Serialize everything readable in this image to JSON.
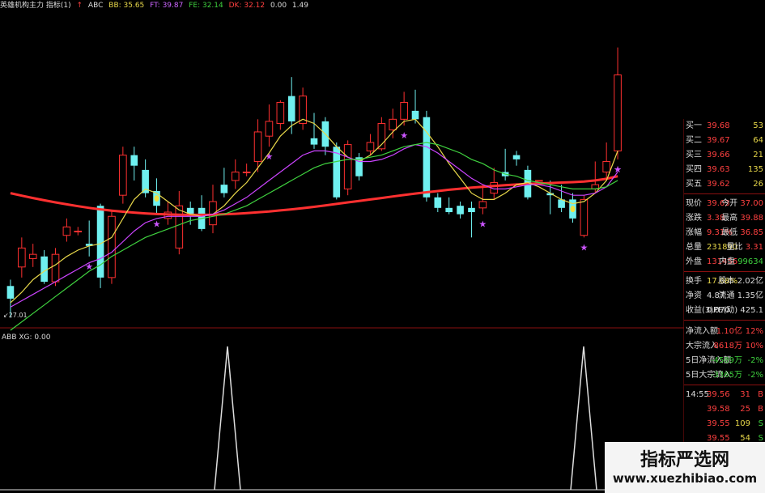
{
  "header": {
    "items": [
      {
        "text": "英雄机构主力 指标(1)",
        "color": "#dddddd"
      },
      {
        "text": "ABC",
        "color": "#dddddd"
      },
      {
        "text": "BB: 35.65",
        "color": "#e8d84a"
      },
      {
        "text": "FT: 39.87",
        "color": "#cc66ff"
      },
      {
        "text": "FE: 32.14",
        "color": "#3fd13f"
      },
      {
        "text": "DK: 32.12",
        "color": "#ff4040"
      },
      {
        "text": "0.00",
        "color": "#dddddd"
      },
      {
        "text": "1.49",
        "color": "#dddddd"
      }
    ]
  },
  "chart_data": [
    {
      "type": "candlestick",
      "title": "",
      "low_label": "27.01",
      "ylim": [
        27.0,
        41.0
      ],
      "candles": [
        {
          "o": 28.6,
          "c": 28.0,
          "h": 28.9,
          "l": 27.1
        },
        {
          "o": 29.5,
          "c": 30.4,
          "h": 30.9,
          "l": 29.0
        },
        {
          "o": 29.9,
          "c": 30.1,
          "h": 30.6,
          "l": 29.5
        },
        {
          "o": 30.0,
          "c": 28.8,
          "h": 30.3,
          "l": 28.7
        },
        {
          "o": 28.8,
          "c": 30.1,
          "h": 30.4,
          "l": 28.6
        },
        {
          "o": 31.0,
          "c": 31.4,
          "h": 31.8,
          "l": 30.7
        },
        {
          "o": 31.2,
          "c": 31.2,
          "h": 31.4,
          "l": 31.0
        },
        {
          "o": 30.6,
          "c": 30.5,
          "h": 31.7,
          "l": 30.0
        },
        {
          "o": 32.4,
          "c": 29.0,
          "h": 32.5,
          "l": 28.5
        },
        {
          "o": 29.0,
          "c": 31.9,
          "h": 32.2,
          "l": 28.7
        },
        {
          "o": 32.9,
          "c": 34.8,
          "h": 35.2,
          "l": 32.5
        },
        {
          "o": 34.8,
          "c": 34.3,
          "h": 35.2,
          "l": 33.6
        },
        {
          "o": 34.1,
          "c": 33.0,
          "h": 34.6,
          "l": 32.8
        },
        {
          "o": 33.1,
          "c": 32.4,
          "h": 33.7,
          "l": 32.0
        },
        {
          "o": 31.8,
          "c": 32.1,
          "h": 32.6,
          "l": 31.5
        },
        {
          "o": 30.4,
          "c": 32.4,
          "h": 33.1,
          "l": 30.1
        },
        {
          "o": 32.3,
          "c": 31.9,
          "h": 32.6,
          "l": 31.5
        },
        {
          "o": 32.3,
          "c": 31.3,
          "h": 32.9,
          "l": 31.2
        },
        {
          "o": 31.5,
          "c": 32.6,
          "h": 33.4,
          "l": 31.1
        },
        {
          "o": 33.4,
          "c": 33.0,
          "h": 34.2,
          "l": 32.8
        },
        {
          "o": 33.6,
          "c": 34.0,
          "h": 34.6,
          "l": 33.2
        },
        {
          "o": 34.0,
          "c": 34.0,
          "h": 34.4,
          "l": 33.8
        },
        {
          "o": 34.5,
          "c": 35.9,
          "h": 36.5,
          "l": 34.0
        },
        {
          "o": 35.7,
          "c": 36.4,
          "h": 37.2,
          "l": 35.2
        },
        {
          "o": 36.3,
          "c": 37.3,
          "h": 37.4,
          "l": 36.0
        },
        {
          "o": 37.6,
          "c": 36.4,
          "h": 38.5,
          "l": 35.8
        },
        {
          "o": 36.3,
          "c": 37.6,
          "h": 38.0,
          "l": 36.0
        },
        {
          "o": 35.6,
          "c": 35.3,
          "h": 36.8,
          "l": 35.1
        },
        {
          "o": 36.4,
          "c": 35.2,
          "h": 36.6,
          "l": 34.8
        },
        {
          "o": 35.2,
          "c": 32.8,
          "h": 35.4,
          "l": 32.7
        },
        {
          "o": 33.2,
          "c": 35.3,
          "h": 35.5,
          "l": 32.9
        },
        {
          "o": 34.7,
          "c": 33.8,
          "h": 34.9,
          "l": 33.6
        },
        {
          "o": 35.0,
          "c": 35.4,
          "h": 35.8,
          "l": 34.8
        },
        {
          "o": 35.1,
          "c": 36.3,
          "h": 36.6,
          "l": 35.0
        },
        {
          "o": 36.0,
          "c": 36.5,
          "h": 37.0,
          "l": 35.6
        },
        {
          "o": 36.5,
          "c": 37.3,
          "h": 37.8,
          "l": 36.2
        },
        {
          "o": 36.9,
          "c": 36.5,
          "h": 37.9,
          "l": 36.3
        },
        {
          "o": 36.6,
          "c": 32.8,
          "h": 36.9,
          "l": 32.6
        },
        {
          "o": 32.8,
          "c": 32.3,
          "h": 33.0,
          "l": 32.1
        },
        {
          "o": 32.3,
          "c": 32.1,
          "h": 32.8,
          "l": 32.0
        },
        {
          "o": 32.4,
          "c": 32.0,
          "h": 32.6,
          "l": 31.8
        },
        {
          "o": 32.3,
          "c": 32.1,
          "h": 32.6,
          "l": 30.9
        },
        {
          "o": 32.3,
          "c": 32.6,
          "h": 33.4,
          "l": 32.0
        },
        {
          "o": 33.0,
          "c": 33.5,
          "h": 34.2,
          "l": 32.7
        },
        {
          "o": 34.0,
          "c": 33.8,
          "h": 35.1,
          "l": 33.6
        },
        {
          "o": 34.8,
          "c": 34.6,
          "h": 35.0,
          "l": 34.3
        },
        {
          "o": 34.1,
          "c": 32.8,
          "h": 34.3,
          "l": 32.7
        },
        {
          "o": 33.6,
          "c": 33.6,
          "h": 33.6,
          "l": 33.6
        },
        {
          "o": 33.0,
          "c": 32.9,
          "h": 33.6,
          "l": 32.0
        },
        {
          "o": 32.7,
          "c": 32.3,
          "h": 33.4,
          "l": 32.1
        },
        {
          "o": 32.7,
          "c": 31.8,
          "h": 33.0,
          "l": 31.6
        },
        {
          "o": 31.0,
          "c": 32.7,
          "h": 32.9,
          "l": 30.9
        },
        {
          "o": 33.2,
          "c": 33.4,
          "h": 34.5,
          "l": 33.0
        },
        {
          "o": 34.0,
          "c": 34.5,
          "h": 35.4,
          "l": 33.6
        },
        {
          "o": 35.0,
          "c": 38.6,
          "h": 39.9,
          "l": 34.6
        }
      ],
      "lines": [
        {
          "color": "#ff3030",
          "values": [
            33.0,
            32.88,
            32.77,
            32.66,
            32.56,
            32.47,
            32.38,
            32.3,
            32.23,
            32.17,
            32.12,
            32.08,
            32.04,
            32.01,
            31.99,
            31.98,
            31.97,
            31.97,
            31.98,
            32.0,
            32.02,
            32.05,
            32.09,
            32.13,
            32.18,
            32.23,
            32.29,
            32.35,
            32.42,
            32.49,
            32.56,
            32.63,
            32.7,
            32.77,
            32.84,
            32.91,
            32.98,
            33.04,
            33.1,
            33.16,
            33.21,
            33.26,
            33.3,
            33.34,
            33.38,
            33.41,
            33.44,
            33.46,
            33.48,
            33.5,
            33.52,
            33.55,
            33.6,
            33.68,
            33.8
          ]
        },
        {
          "color": "#e8d84a",
          "values": [
            27.8,
            28.3,
            28.9,
            29.3,
            29.6,
            30.0,
            30.3,
            30.5,
            30.6,
            30.9,
            31.8,
            32.7,
            33.2,
            33.0,
            32.6,
            32.2,
            32.0,
            31.9,
            32.0,
            32.4,
            33.0,
            33.5,
            34.2,
            34.9,
            35.7,
            36.2,
            36.5,
            36.3,
            35.8,
            35.2,
            34.7,
            34.5,
            34.8,
            35.3,
            35.9,
            36.4,
            36.5,
            35.9,
            35.2,
            34.4,
            33.7,
            33.0,
            32.7,
            32.7,
            33.0,
            33.4,
            33.5,
            33.3,
            33.0,
            32.7,
            32.5,
            32.6,
            33.0,
            33.6,
            35.0
          ]
        },
        {
          "color": "#cc44ff",
          "values": [
            27.6,
            27.9,
            28.2,
            28.5,
            28.8,
            29.1,
            29.4,
            29.7,
            29.9,
            30.2,
            30.7,
            31.2,
            31.6,
            31.8,
            31.9,
            31.9,
            31.9,
            31.9,
            32.0,
            32.2,
            32.5,
            32.8,
            33.2,
            33.6,
            34.0,
            34.4,
            34.8,
            35.0,
            35.0,
            34.9,
            34.7,
            34.5,
            34.5,
            34.6,
            34.8,
            35.1,
            35.3,
            35.2,
            34.9,
            34.5,
            34.1,
            33.7,
            33.4,
            33.2,
            33.2,
            33.3,
            33.4,
            33.4,
            33.3,
            33.1,
            32.9,
            32.9,
            33.0,
            33.3,
            34.0
          ]
        },
        {
          "color": "#3fd13f",
          "values": [
            26.5,
            26.9,
            27.3,
            27.7,
            28.1,
            28.5,
            28.9,
            29.3,
            29.6,
            30.0,
            30.3,
            30.6,
            30.9,
            31.1,
            31.3,
            31.5,
            31.7,
            31.8,
            31.9,
            32.0,
            32.2,
            32.4,
            32.7,
            33.0,
            33.3,
            33.6,
            33.9,
            34.2,
            34.4,
            34.5,
            34.6,
            34.6,
            34.7,
            34.8,
            35.0,
            35.2,
            35.3,
            35.4,
            35.3,
            35.1,
            34.9,
            34.6,
            34.4,
            34.1,
            33.9,
            33.8,
            33.6,
            33.5,
            33.4,
            33.3,
            33.2,
            33.2,
            33.2,
            33.3,
            33.6
          ]
        }
      ],
      "series": [
        {
          "name": "BB",
          "values": [],
          "color": "#e8d84a"
        },
        {
          "name": "FT",
          "values": [],
          "color": "#cc66ff"
        },
        {
          "name": "FE",
          "values": [],
          "color": "#3fd13f"
        },
        {
          "name": "DK",
          "values": [],
          "color": "#ff4040"
        }
      ],
      "buy_stars": [
        7,
        13,
        23,
        35,
        42,
        51,
        56,
        62
      ],
      "dots": [
        13,
        50
      ]
    },
    {
      "type": "line",
      "title": "ABB XG: 0.00",
      "ylim": [
        0,
        1
      ],
      "spikes": [
        {
          "center": 281,
          "value": 1
        },
        {
          "center": 721,
          "value": 1
        }
      ],
      "color": "#dddddd"
    }
  ],
  "quote_panel": {
    "bids": [
      {
        "label": "买一",
        "price": "39.68",
        "vol": "53"
      },
      {
        "label": "买二",
        "price": "39.67",
        "vol": "64"
      },
      {
        "label": "买三",
        "price": "39.66",
        "vol": "21"
      },
      {
        "label": "买四",
        "price": "39.63",
        "vol": "135"
      },
      {
        "label": "买五",
        "price": "39.62",
        "vol": "26"
      }
    ],
    "stats": [
      {
        "l1": "现价",
        "v1": "39.63",
        "l2": "今开",
        "v2": "37.00"
      },
      {
        "l1": "涨跌",
        "v1": "3.38",
        "l2": "最高",
        "v2": "39.88"
      },
      {
        "l1": "涨幅",
        "v1": "9.31%",
        "l2": "最低",
        "v2": "36.85"
      },
      {
        "l1": "总量",
        "v1": "231890",
        "l2": "量比",
        "v2": "3.31"
      },
      {
        "l1": "外盘",
        "v1": "131456",
        "l2": "内盘",
        "v2": "99634"
      },
      {
        "l1": "换手",
        "v1": "17.08%",
        "l2": "股本",
        "v2": "2.02亿"
      },
      {
        "l1": "净资",
        "v1": "4.87",
        "l2": "流通",
        "v2": "1.35亿"
      },
      {
        "l1": "收益(3)",
        "v1": "0.070",
        "l2": "PE(动)",
        "v2": "425.1"
      }
    ],
    "flows": [
      {
        "label": "净流入额",
        "val": "1.10亿",
        "pct": "12%"
      },
      {
        "label": "大宗流入",
        "val": "8618万",
        "pct": "10%"
      },
      {
        "label": "5日净流入额",
        "val": "-4589万",
        "pct": "-2%"
      },
      {
        "label": "5日大宗流入",
        "val": "-3365万",
        "pct": "-2%"
      }
    ],
    "ticks": [
      {
        "time": "14:55",
        "price": "39.56",
        "vol": "31",
        "side": "B"
      },
      {
        "time": "",
        "price": "39.58",
        "vol": "25",
        "side": "B"
      },
      {
        "time": "",
        "price": "39.55",
        "vol": "109",
        "side": "S"
      },
      {
        "time": "",
        "price": "39.55",
        "vol": "54",
        "side": "S"
      }
    ]
  },
  "watermark": {
    "line1": "指标严选网",
    "line2": "www.xuezhibiao.com"
  }
}
